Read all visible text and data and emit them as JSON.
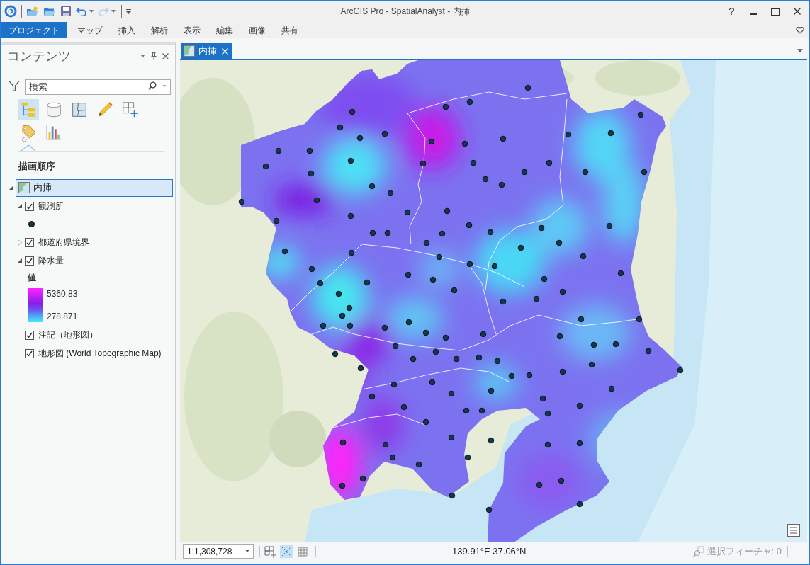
{
  "window": {
    "title": "ArcGIS Pro - SpatialAnalyst - 内挿",
    "help": "?"
  },
  "quick_access": [
    {
      "kind": "new",
      "disabled": false
    },
    {
      "kind": "open",
      "disabled": false
    },
    {
      "kind": "save",
      "disabled": false
    },
    {
      "kind": "undo",
      "disabled": false
    },
    {
      "kind": "redo",
      "disabled": true
    }
  ],
  "ribbon_tabs": [
    {
      "label": "プロジェクト",
      "selected": true
    },
    {
      "label": "マップ",
      "selected": false
    },
    {
      "label": "挿入",
      "selected": false
    },
    {
      "label": "解析",
      "selected": false
    },
    {
      "label": "表示",
      "selected": false
    },
    {
      "label": "編集",
      "selected": false
    },
    {
      "label": "画像",
      "selected": false
    },
    {
      "label": "共有",
      "selected": false
    }
  ],
  "contents": {
    "title": "コンテンツ",
    "search": {
      "placeholder": "検索"
    },
    "views": [
      {
        "kind": "order",
        "selected": true
      },
      {
        "kind": "source",
        "selected": false
      },
      {
        "kind": "selection",
        "selected": false
      },
      {
        "kind": "editing",
        "selected": false
      },
      {
        "kind": "snapping",
        "selected": false
      },
      {
        "kind": "labeling",
        "selected": false
      },
      {
        "kind": "charts",
        "selected": false
      }
    ],
    "section": "描画順序",
    "tree": [
      {
        "label": "内挿",
        "selected": true,
        "expanded": true,
        "children": [
          {
            "label": "観測所",
            "selected": false,
            "checked": true,
            "expanded": true,
            "legend": {
              "kind": "point"
            }
          },
          {
            "label": "都道府県境界",
            "selected": false,
            "checked": true,
            "expanded": false
          },
          {
            "label": "降水量",
            "selected": false,
            "checked": true,
            "expanded": true,
            "legend": {
              "kind": "ramp",
              "title": "値",
              "high": "5360.83",
              "low": "278.871"
            }
          },
          {
            "label": "注記（地形図）",
            "selected": false,
            "checked": true
          },
          {
            "label": "地形図 (World Topographic Map)",
            "selected": false,
            "checked": true
          }
        ]
      }
    ]
  },
  "map_tabs": [
    {
      "label": "内挿",
      "selected": true
    }
  ],
  "status_bar": {
    "scale": "1:1,308,728",
    "tools": [
      {
        "kind": "snapping",
        "selected": false
      },
      {
        "kind": "guides",
        "selected": true
      },
      {
        "kind": "grid",
        "selected": false
      }
    ],
    "coordinates": "139.91°E 37.06°N",
    "selection": {
      "label": "選択フィーチャ: 0",
      "disabled": true
    }
  }
}
